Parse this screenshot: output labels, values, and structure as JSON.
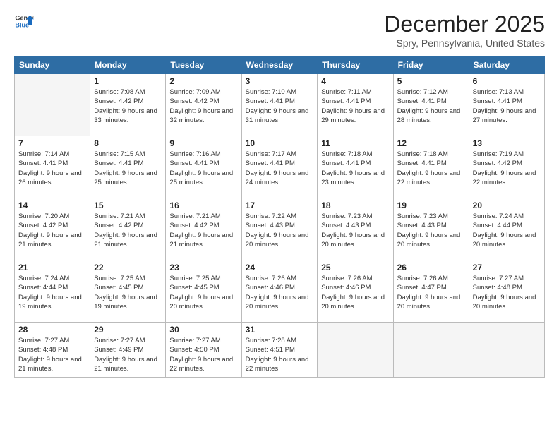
{
  "header": {
    "logo_general": "General",
    "logo_blue": "Blue",
    "month_title": "December 2025",
    "location": "Spry, Pennsylvania, United States"
  },
  "days_of_week": [
    "Sunday",
    "Monday",
    "Tuesday",
    "Wednesday",
    "Thursday",
    "Friday",
    "Saturday"
  ],
  "weeks": [
    [
      {
        "day": "",
        "info": ""
      },
      {
        "day": "1",
        "info": "Sunrise: 7:08 AM\nSunset: 4:42 PM\nDaylight: 9 hours\nand 33 minutes."
      },
      {
        "day": "2",
        "info": "Sunrise: 7:09 AM\nSunset: 4:42 PM\nDaylight: 9 hours\nand 32 minutes."
      },
      {
        "day": "3",
        "info": "Sunrise: 7:10 AM\nSunset: 4:41 PM\nDaylight: 9 hours\nand 31 minutes."
      },
      {
        "day": "4",
        "info": "Sunrise: 7:11 AM\nSunset: 4:41 PM\nDaylight: 9 hours\nand 29 minutes."
      },
      {
        "day": "5",
        "info": "Sunrise: 7:12 AM\nSunset: 4:41 PM\nDaylight: 9 hours\nand 28 minutes."
      },
      {
        "day": "6",
        "info": "Sunrise: 7:13 AM\nSunset: 4:41 PM\nDaylight: 9 hours\nand 27 minutes."
      }
    ],
    [
      {
        "day": "7",
        "info": "Sunrise: 7:14 AM\nSunset: 4:41 PM\nDaylight: 9 hours\nand 26 minutes."
      },
      {
        "day": "8",
        "info": "Sunrise: 7:15 AM\nSunset: 4:41 PM\nDaylight: 9 hours\nand 25 minutes."
      },
      {
        "day": "9",
        "info": "Sunrise: 7:16 AM\nSunset: 4:41 PM\nDaylight: 9 hours\nand 25 minutes."
      },
      {
        "day": "10",
        "info": "Sunrise: 7:17 AM\nSunset: 4:41 PM\nDaylight: 9 hours\nand 24 minutes."
      },
      {
        "day": "11",
        "info": "Sunrise: 7:18 AM\nSunset: 4:41 PM\nDaylight: 9 hours\nand 23 minutes."
      },
      {
        "day": "12",
        "info": "Sunrise: 7:18 AM\nSunset: 4:41 PM\nDaylight: 9 hours\nand 22 minutes."
      },
      {
        "day": "13",
        "info": "Sunrise: 7:19 AM\nSunset: 4:42 PM\nDaylight: 9 hours\nand 22 minutes."
      }
    ],
    [
      {
        "day": "14",
        "info": "Sunrise: 7:20 AM\nSunset: 4:42 PM\nDaylight: 9 hours\nand 21 minutes."
      },
      {
        "day": "15",
        "info": "Sunrise: 7:21 AM\nSunset: 4:42 PM\nDaylight: 9 hours\nand 21 minutes."
      },
      {
        "day": "16",
        "info": "Sunrise: 7:21 AM\nSunset: 4:42 PM\nDaylight: 9 hours\nand 21 minutes."
      },
      {
        "day": "17",
        "info": "Sunrise: 7:22 AM\nSunset: 4:43 PM\nDaylight: 9 hours\nand 20 minutes."
      },
      {
        "day": "18",
        "info": "Sunrise: 7:23 AM\nSunset: 4:43 PM\nDaylight: 9 hours\nand 20 minutes."
      },
      {
        "day": "19",
        "info": "Sunrise: 7:23 AM\nSunset: 4:43 PM\nDaylight: 9 hours\nand 20 minutes."
      },
      {
        "day": "20",
        "info": "Sunrise: 7:24 AM\nSunset: 4:44 PM\nDaylight: 9 hours\nand 20 minutes."
      }
    ],
    [
      {
        "day": "21",
        "info": "Sunrise: 7:24 AM\nSunset: 4:44 PM\nDaylight: 9 hours\nand 19 minutes."
      },
      {
        "day": "22",
        "info": "Sunrise: 7:25 AM\nSunset: 4:45 PM\nDaylight: 9 hours\nand 19 minutes."
      },
      {
        "day": "23",
        "info": "Sunrise: 7:25 AM\nSunset: 4:45 PM\nDaylight: 9 hours\nand 20 minutes."
      },
      {
        "day": "24",
        "info": "Sunrise: 7:26 AM\nSunset: 4:46 PM\nDaylight: 9 hours\nand 20 minutes."
      },
      {
        "day": "25",
        "info": "Sunrise: 7:26 AM\nSunset: 4:46 PM\nDaylight: 9 hours\nand 20 minutes."
      },
      {
        "day": "26",
        "info": "Sunrise: 7:26 AM\nSunset: 4:47 PM\nDaylight: 9 hours\nand 20 minutes."
      },
      {
        "day": "27",
        "info": "Sunrise: 7:27 AM\nSunset: 4:48 PM\nDaylight: 9 hours\nand 20 minutes."
      }
    ],
    [
      {
        "day": "28",
        "info": "Sunrise: 7:27 AM\nSunset: 4:48 PM\nDaylight: 9 hours\nand 21 minutes."
      },
      {
        "day": "29",
        "info": "Sunrise: 7:27 AM\nSunset: 4:49 PM\nDaylight: 9 hours\nand 21 minutes."
      },
      {
        "day": "30",
        "info": "Sunrise: 7:27 AM\nSunset: 4:50 PM\nDaylight: 9 hours\nand 22 minutes."
      },
      {
        "day": "31",
        "info": "Sunrise: 7:28 AM\nSunset: 4:51 PM\nDaylight: 9 hours\nand 22 minutes."
      },
      {
        "day": "",
        "info": ""
      },
      {
        "day": "",
        "info": ""
      },
      {
        "day": "",
        "info": ""
      }
    ]
  ]
}
